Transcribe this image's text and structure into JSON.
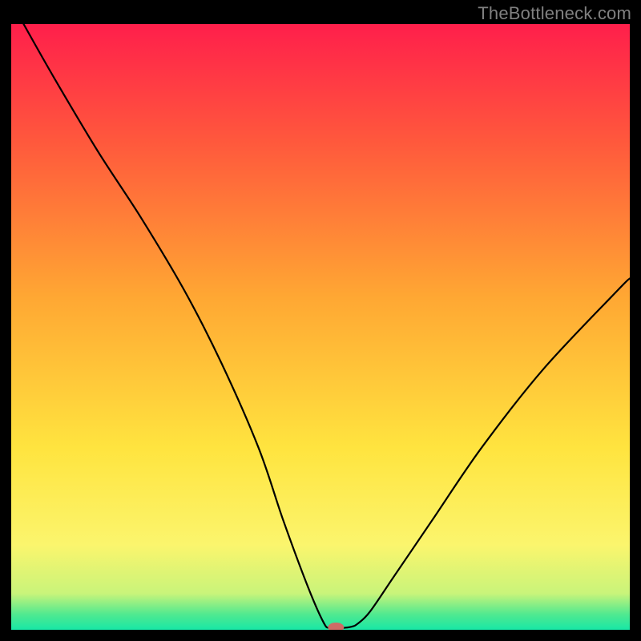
{
  "watermark": "TheBottleneck.com",
  "chart_data": {
    "type": "line",
    "title": "",
    "xlabel": "",
    "ylabel": "",
    "xlim": [
      0,
      100
    ],
    "ylim": [
      0,
      100
    ],
    "grid": false,
    "legend": false,
    "background_gradient": {
      "stops": [
        {
          "offset": 0.0,
          "color": "#ff1f4b"
        },
        {
          "offset": 0.2,
          "color": "#ff5a3c"
        },
        {
          "offset": 0.45,
          "color": "#ffa733"
        },
        {
          "offset": 0.7,
          "color": "#ffe43f"
        },
        {
          "offset": 0.86,
          "color": "#fbf56d"
        },
        {
          "offset": 0.94,
          "color": "#c9f47a"
        },
        {
          "offset": 0.975,
          "color": "#4fe990"
        },
        {
          "offset": 1.0,
          "color": "#18e7a6"
        }
      ]
    },
    "series": [
      {
        "name": "bottleneck-curve",
        "color": "#000000",
        "stroke_width": 2.2,
        "x": [
          2,
          7,
          14,
          21,
          28,
          34,
          40,
          44,
          48,
          50.5,
          51.5,
          53.5,
          55,
          56,
          58,
          62,
          68,
          76,
          86,
          98,
          100
        ],
        "y": [
          100,
          91,
          79,
          68,
          56,
          44,
          30,
          18,
          7,
          1.2,
          0.3,
          0.3,
          0.5,
          1.0,
          3,
          9,
          18,
          30,
          43,
          56,
          58
        ]
      }
    ],
    "marker": {
      "name": "optimal-point",
      "x": 52.5,
      "y": 0.4,
      "color": "#cf6b66",
      "rx": 10,
      "ry": 6
    }
  }
}
